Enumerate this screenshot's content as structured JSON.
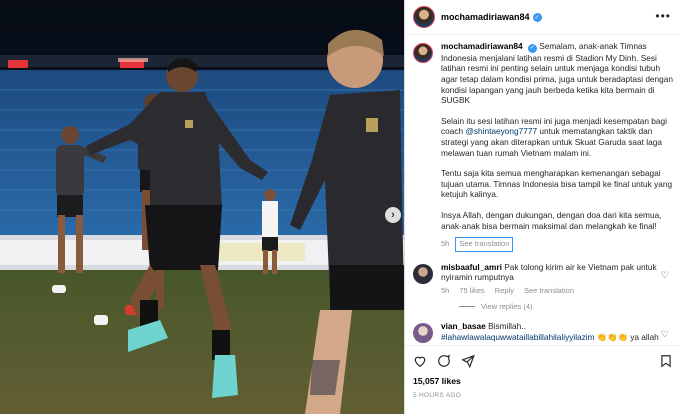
{
  "post": {
    "username": "mochamadiriawan84",
    "verified": true
  },
  "caption": {
    "username": "mochamadiriawan84",
    "p1": "Semalam, anak-anak Timnas Indonesia menjalani latihan resmi di Stadion My Dinh. Sesi latihan resmi ini penting selain untuk menjaga kondisi tubuh agar tetap dalam kondisi prima, juga untuk beradaptasi dengan kondisi lapangan yang jauh berbeda ketika kita bermain di SUGBK",
    "p2a": "Selain itu sesi latihan resmi ini juga menjadi kesempatan bagi coach ",
    "p2mention": "@shintaeyong7777",
    "p2b": " untuk mematangkan taktik dan strategi yang akan diterapkan untuk Skuat Garuda saat laga melawan tuan rumah Vietnam malam ini.",
    "p3": "Tentu saja kita semua mengharapkan kemenangan sebagai tujuan utama. Timnas Indonesia bisa tampil ke final untuk yang ketujuh kalinya.",
    "p4": "Insya Allah, dengan dukungan, dengan doa dari kita semua, anak-anak bisa bermain maksimal dan melangkah ke final!",
    "time": "5h",
    "see_translation": "See translation"
  },
  "comments": [
    {
      "username": "misbaaful_amri",
      "text": "Pak tolong kirim air ke Vietnam pak untuk nyiramin rumputnya",
      "time": "5h",
      "likes": "75 likes",
      "reply": "Reply",
      "see_translation": "See translation",
      "view_replies": "View replies (4)"
    },
    {
      "username": "vian_basae",
      "text": "Bismillah..",
      "hashtag": "#lahawlawalaquwwataillabillahilaliyyilazim",
      "emoji": "👏👏👏",
      "text2": " ya allah bantulah timnas kami berjuangan di pertandingan nanti"
    }
  ],
  "footer": {
    "likes": "15,057 likes",
    "time_ago": "5 HOURS AGO"
  },
  "icons": {
    "heart": "heart-icon",
    "comment": "comment-icon",
    "share": "share-icon",
    "save": "bookmark-icon",
    "more": "more-icon",
    "next": "chevron-right-icon"
  },
  "colors": {
    "link": "#00376b",
    "verified": "#3897f0",
    "muted": "#8e8e8e"
  }
}
